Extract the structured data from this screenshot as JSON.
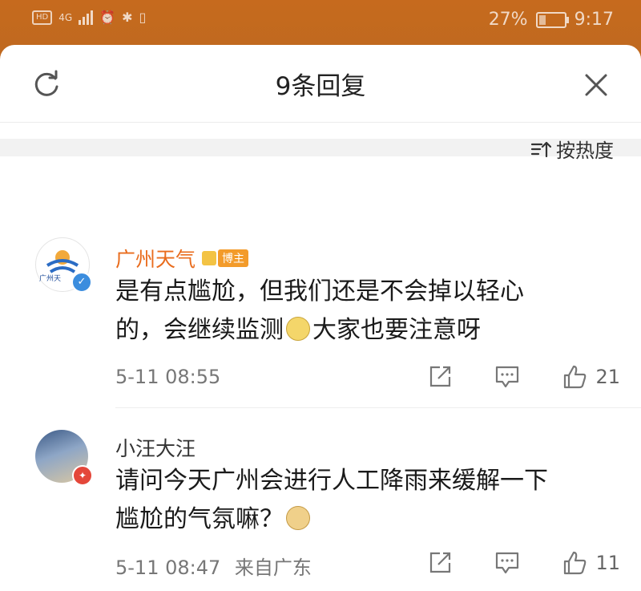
{
  "status_bar": {
    "left_badge": "HD",
    "network": "4G",
    "battery_percent": "27%",
    "battery_level": 0.27,
    "time": "9:17"
  },
  "header": {
    "title": "9条回复"
  },
  "sort": {
    "label": "按热度"
  },
  "comments": [
    {
      "username": "广州天气",
      "avatar_label": "广州天",
      "tag": "博主",
      "text_line1": "是有点尴尬，但我们还是不会掉以轻心",
      "text_line2a": "的，会继续监测",
      "text_line2b": "大家也要注意呀",
      "time": "5-11 08:55",
      "source": "",
      "likes": "21"
    },
    {
      "username": "小汪大汪",
      "tag": "",
      "text_line1": "请问今天广州会进行人工降雨来缓解一下",
      "text_line2a": "尴尬的气氛嘛？",
      "text_line2b": "",
      "time": "5-11 08:47",
      "source": "来自广东",
      "likes": "11"
    }
  ],
  "icons": [
    "refresh-icon",
    "close-icon",
    "sort-icon",
    "share-icon",
    "reply-icon",
    "like-icon"
  ],
  "colors": {
    "accent_orange": "#e96c1d",
    "status_bg": "#c0691f",
    "verified_blue": "#3b8dde"
  }
}
